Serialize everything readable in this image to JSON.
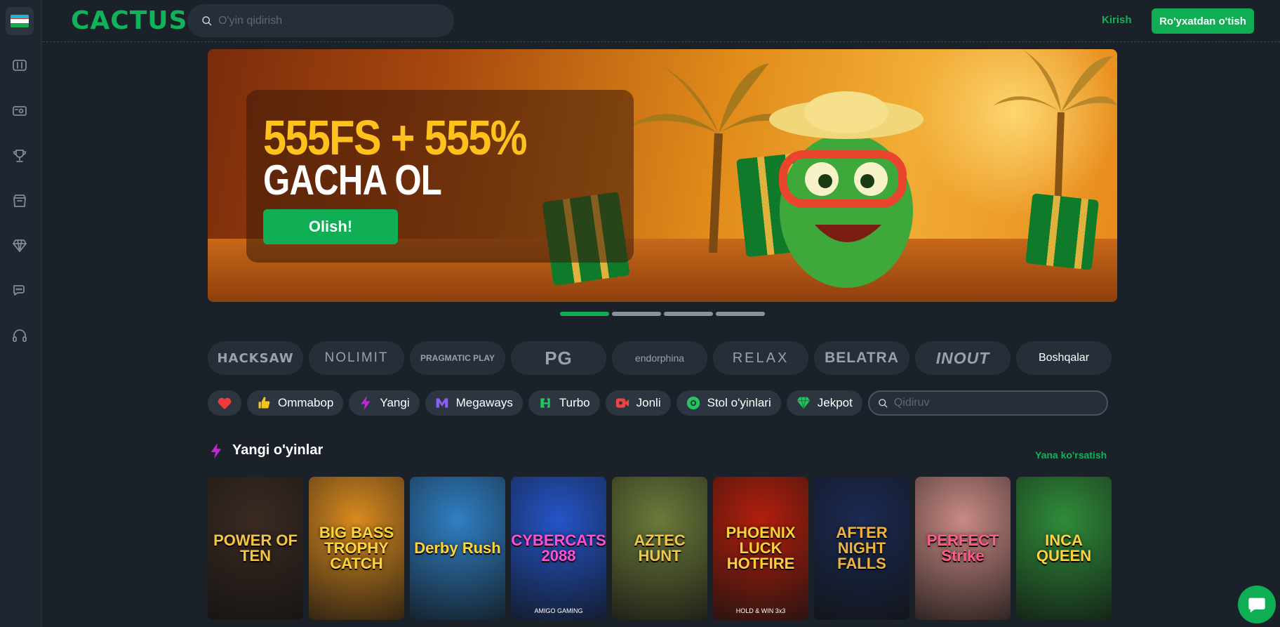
{
  "header": {
    "logo": "CACTUS",
    "search_placeholder": "O'yin qidirish",
    "login_label": "Kirish",
    "register_label": "Ro'yxatdan o'tish"
  },
  "sidebar": {
    "flag": "uzbekistan-flag",
    "icons": [
      "slots-icon",
      "sports-ticket-icon",
      "trophy-icon",
      "store-icon",
      "diamond-icon",
      "chat-icon",
      "support-headset-icon"
    ]
  },
  "banner": {
    "line1": "555FS + 555%",
    "line2": "GACHA OL",
    "cta": "Olish!",
    "slides_count": 4,
    "active_slide": 1
  },
  "providers": {
    "items": [
      "HACKSAW",
      "NOLIMIT",
      "PRAGMATIC PLAY",
      "PG",
      "endorphina",
      "RELAX",
      "BELATRA",
      "INOUT"
    ],
    "more_label": "Boshqalar"
  },
  "filters": {
    "items": [
      {
        "label": "Ommabop",
        "icon": "thumbs-up-icon",
        "color": "#f5c518"
      },
      {
        "label": "Yangi",
        "icon": "lightning-icon",
        "color": "#c026d3"
      },
      {
        "label": "Megaways",
        "icon": "megaways-icon",
        "color": "#8b5cf6"
      },
      {
        "label": "Turbo",
        "icon": "turbo-icon",
        "color": "#22c55e"
      },
      {
        "label": "Jonli",
        "icon": "live-camera-icon",
        "color": "#ef4444"
      },
      {
        "label": "Stol o'yinlari",
        "icon": "table-games-icon",
        "color": "#22c55e"
      },
      {
        "label": "Jekpot",
        "icon": "diamond-icon",
        "color": "#22c55e"
      }
    ],
    "search_placeholder": "Qidiruv"
  },
  "section": {
    "title": "Yangi o'yinlar",
    "show_more": "Yana ko'rsatish"
  },
  "games": [
    {
      "title": "POWER OF TEN",
      "bg": "#3a2a22",
      "fg": "#f4c542",
      "label": ""
    },
    {
      "title": "BIG BASS TROPHY CATCH",
      "bg": "#d98a1f",
      "fg": "#ffd43b",
      "label": ""
    },
    {
      "title": "Derby Rush",
      "bg": "#2f7fc4",
      "fg": "#ffd43b",
      "label": ""
    },
    {
      "title": "CYBERCATS 2088",
      "bg": "#2455c8",
      "fg": "#ff4fd8",
      "label": "AMIGO GAMING"
    },
    {
      "title": "AZTEC HUNT",
      "bg": "#6b7a3a",
      "fg": "#f0c64a",
      "label": ""
    },
    {
      "title": "PHOENIX LUCK HOTFIRE",
      "bg": "#b21f0d",
      "fg": "#ffcf3b",
      "label": "HOLD & WIN 3x3"
    },
    {
      "title": "AFTER NIGHT FALLS",
      "bg": "#1b2a52",
      "fg": "#f1b23b",
      "label": ""
    },
    {
      "title": "PERFECT Strike",
      "bg": "#c98a84",
      "fg": "#ff5a8a",
      "label": ""
    },
    {
      "title": "INCA QUEEN",
      "bg": "#2f8c3a",
      "fg": "#ffd23b",
      "label": ""
    }
  ]
}
